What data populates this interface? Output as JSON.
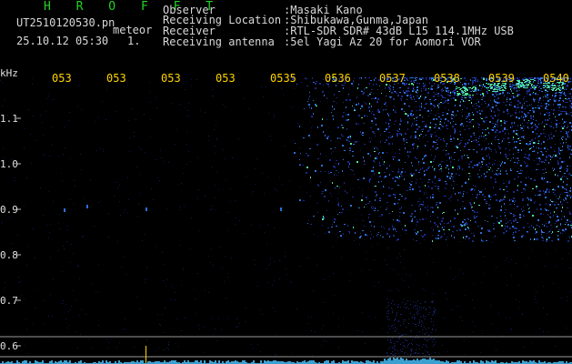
{
  "header": {
    "title": "H R O F F T",
    "file_name": "UT2510120530.pn",
    "kind": "meteor",
    "datetime": "25.10.12 05:30",
    "count": "1."
  },
  "station": [
    {
      "key": "Observer",
      "value": ":Masaki Kano"
    },
    {
      "key": "Receiving Location",
      "value": ":Shibukawa,Gunma,Japan"
    },
    {
      "key": "Receiver",
      "value": ":RTL-SDR SDR# 43dB L15 114.1MHz USB"
    },
    {
      "key": "Receiving antenna",
      "value": ":5el Yagi Az 20 for Aomori VOR"
    }
  ],
  "axis": {
    "unit": "kHz",
    "freq_labels": [
      "1.1",
      "1.0",
      "0.9",
      "0.8",
      "0.7",
      "0.6"
    ],
    "time_labels": [
      "053",
      "053",
      "053",
      "053",
      "0535",
      "0536",
      "0537",
      "0538",
      "0539",
      "0540"
    ]
  },
  "colors": {
    "background": "#000000",
    "title": "#22d422",
    "text": "#d8d8d8",
    "time_label": "#ffd400",
    "signal_low": "#1a2a8a",
    "signal_mid": "#2c6fd8",
    "signal_high": "#50e0a0",
    "marker_line": "#ffd400",
    "baseline": "#3aa0d0"
  }
}
